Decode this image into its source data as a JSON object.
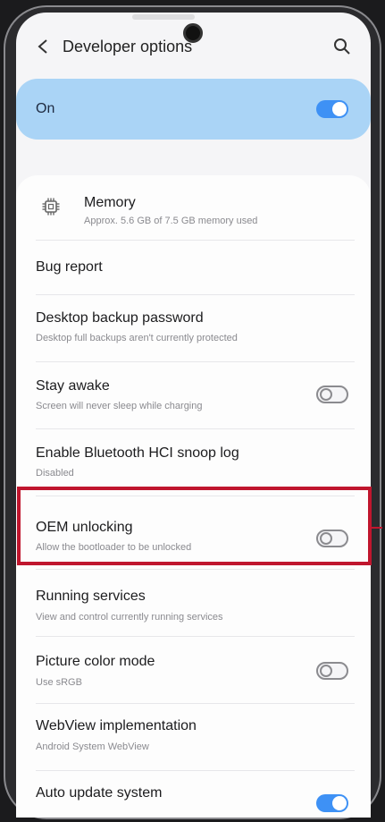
{
  "header": {
    "title": "Developer options"
  },
  "master": {
    "label": "On",
    "enabled": true
  },
  "colors": {
    "accent": "#3e91f5",
    "master_bg": "#aad4f6",
    "highlight": "#c0162e"
  },
  "icons": {
    "back": "arrow-left-icon",
    "search": "search-icon",
    "memory": "memory-chip-icon"
  },
  "settings": [
    {
      "title": "Memory",
      "subtitle": "Approx. 5.6 GB of 7.5 GB memory used"
    },
    {
      "title": "Bug report"
    },
    {
      "title": "Desktop backup password",
      "subtitle": "Desktop full backups aren't currently protected"
    },
    {
      "title": "Stay awake",
      "subtitle": "Screen will never sleep while charging",
      "toggle": false
    },
    {
      "title": "Enable Bluetooth HCI snoop log",
      "subtitle": "Disabled"
    },
    {
      "title": "OEM unlocking",
      "subtitle": "Allow the bootloader to be unlocked",
      "toggle": false,
      "highlighted": true
    },
    {
      "title": "Running services",
      "subtitle": "View and control currently running services"
    },
    {
      "title": "Picture color mode",
      "subtitle": "Use sRGB",
      "toggle": false
    },
    {
      "title": "WebView implementation",
      "subtitle": "Android System WebView"
    },
    {
      "title": "Auto update system",
      "toggle": true
    }
  ]
}
